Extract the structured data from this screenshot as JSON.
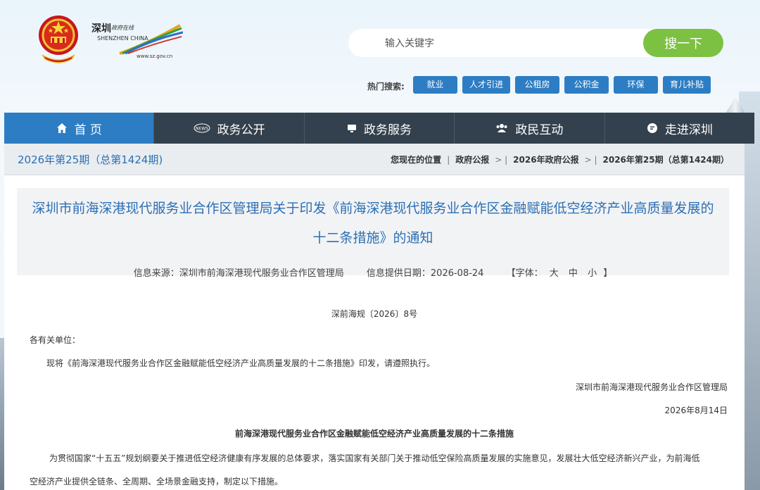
{
  "header": {
    "logo": {
      "cn_text": "深圳",
      "sub_text": "政府在线",
      "en_text": "SHENZHEN CHINA",
      "url": "www.sz.gov.cn"
    },
    "search": {
      "placeholder": "输入关键字",
      "button_label": "搜一下"
    },
    "hot_search": {
      "label": "热门搜索:",
      "tags": [
        "就业",
        "人才引进",
        "公租房",
        "公积金",
        "环保",
        "育儿补贴"
      ]
    }
  },
  "nav": {
    "items": [
      {
        "label": "首 页",
        "icon": "home-icon"
      },
      {
        "label": "政务公开",
        "icon": "news-icon"
      },
      {
        "label": "政务服务",
        "icon": "monitor-icon"
      },
      {
        "label": "政民互动",
        "icon": "users-icon"
      },
      {
        "label": "走进深圳",
        "icon": "chat-icon"
      }
    ],
    "active_index": 0
  },
  "breadcrumb_bar": {
    "issue": "2026年第25期（总第1424期)",
    "location_label": "您现在的位置",
    "crumbs": [
      "政府公报",
      "2026年政府公报",
      "2026年第25期（总第1424期）"
    ]
  },
  "article": {
    "title_line1": "深圳市前海深港现代服务业合作区管理局关于印发《前海深港现代服务业合作区金融赋能低空经济产业高质量发展的",
    "title_line2": "十二条措施》的通知",
    "source": "信息来源：深圳市前海深港现代服务业合作区管理局",
    "date": "信息提供日期：2026-08-24",
    "font_size_label": "【字体：",
    "font_sizes": [
      "大",
      "中",
      "小"
    ],
    "font_size_close": "】",
    "doc_number": "深前海规〔2026〕8号",
    "recipient": "各有关单位：",
    "body_line": "现将《前海深港现代服务业合作区金融赋能低空经济产业高质量发展的十二条措施》印发，请遵照执行。",
    "signature": "深圳市前海深港现代服务业合作区管理局",
    "sign_date": "2026年8月14日",
    "subtitle": "前海深港现代服务业合作区金融赋能低空经济产业高质量发展的十二条措施",
    "para1_line1": "为贯彻国家“十五五”规划纲要关于推进低空经济健康有序发展的总体要求，落实国家有关部门关于推动低空保险高质量发展的实施意见，发展壮大低空经济新兴产业，为前海低",
    "para1_line2": "空经济产业提供全链条、全周期、全场景金融支持，制定以下措施。"
  },
  "colors": {
    "nav_bg": "#33404d",
    "nav_active": "#2d7dc4",
    "search_button": "#7cc142",
    "title_blue": "#2d6fb3",
    "tag_blue": "#2d7dc4"
  }
}
